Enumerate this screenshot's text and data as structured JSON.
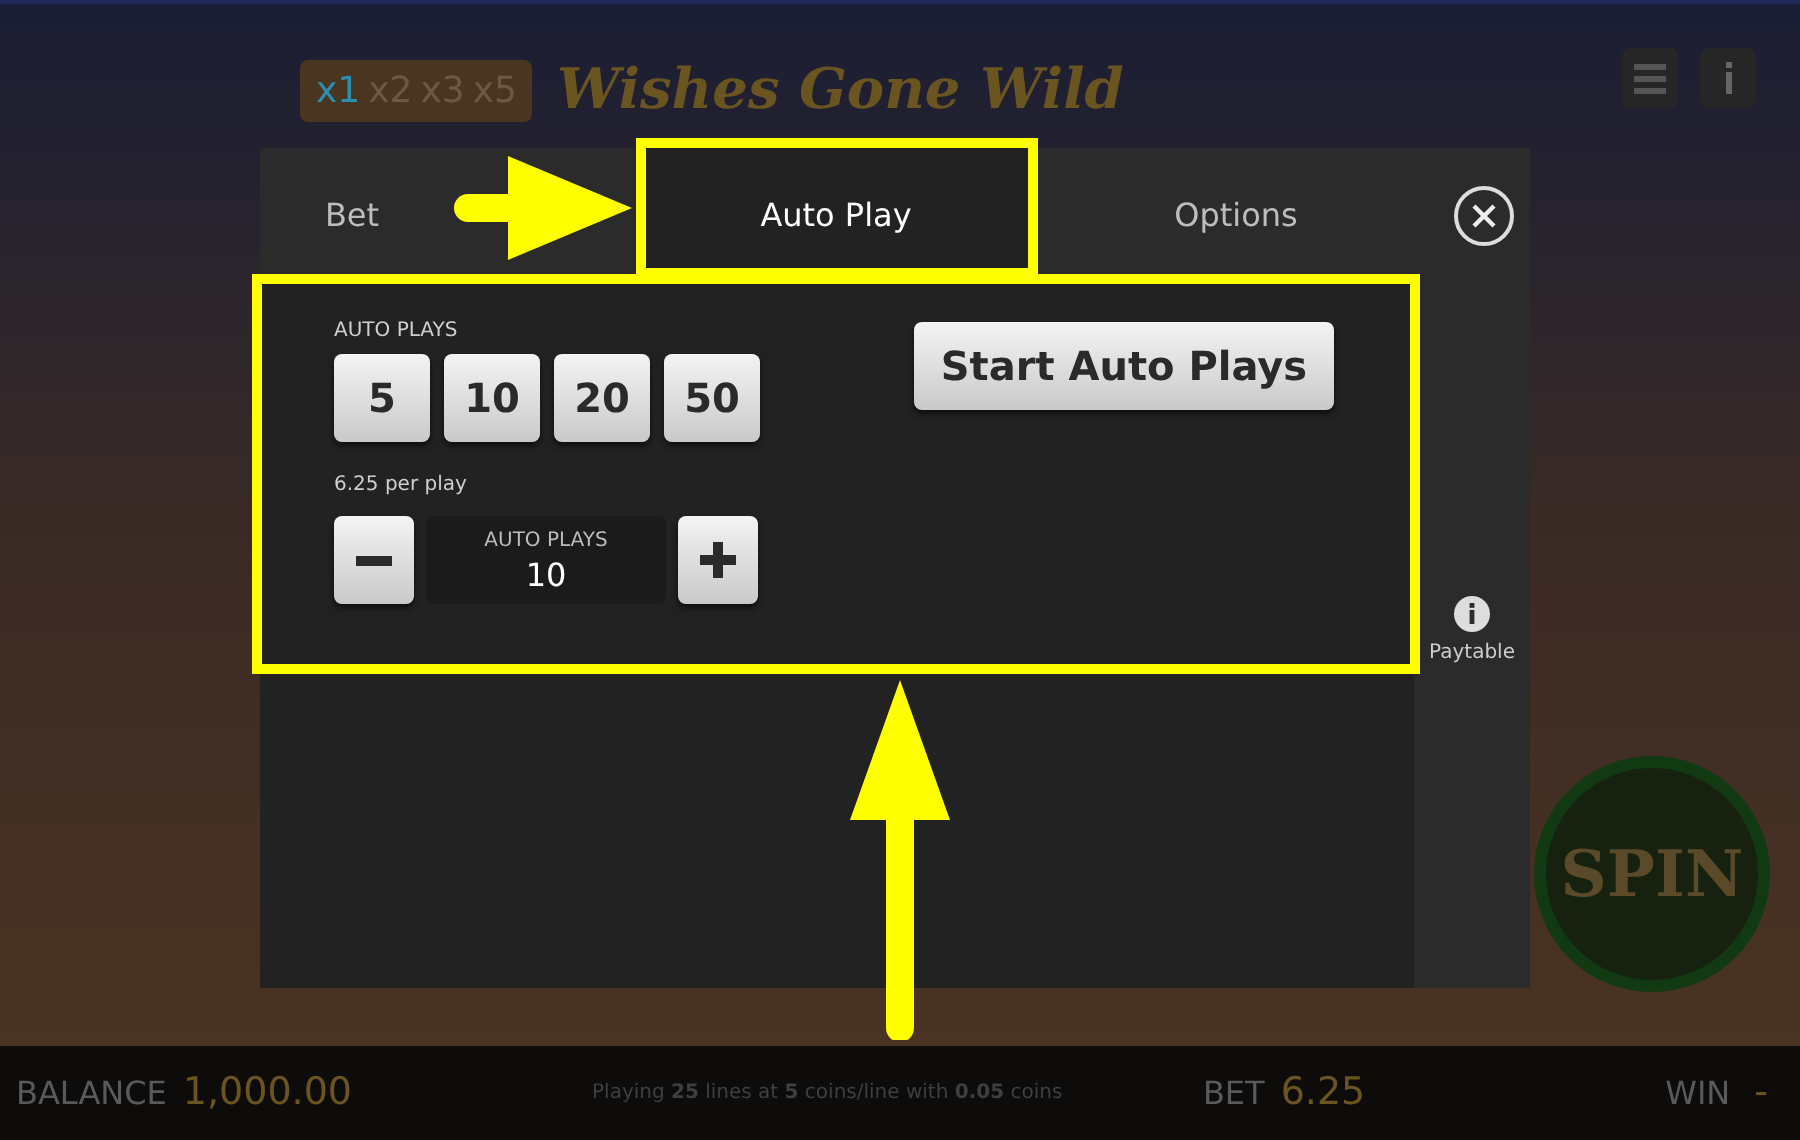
{
  "game": {
    "multipliers": [
      {
        "label": "x1",
        "selected": true
      },
      {
        "label": "x2",
        "selected": false
      },
      {
        "label": "x3",
        "selected": false
      },
      {
        "label": "x5",
        "selected": false
      }
    ],
    "logo": "Wishes Gone Wild",
    "spin_button": "SPIN"
  },
  "dialog": {
    "tabs": [
      {
        "label": "Bet",
        "selected": false
      },
      {
        "label": "Auto Play",
        "selected": true
      },
      {
        "label": "Options",
        "selected": false
      }
    ],
    "auto_plays_label": "AUTO PLAYS",
    "presets": [
      "5",
      "10",
      "20",
      "50"
    ],
    "start_button": "Start Auto Plays",
    "per_play": "6.25 per play",
    "stepper": {
      "label": "AUTO PLAYS",
      "value": "10"
    },
    "paytable": "Paytable"
  },
  "status_bar": {
    "balance_label": "BALANCE",
    "balance": "1,000.00",
    "info": "Playing **25** lines at **5** coins/line with **0.05** coins",
    "bet_label": "BET",
    "bet": "6.25",
    "win_label": "WIN",
    "win": "-"
  }
}
